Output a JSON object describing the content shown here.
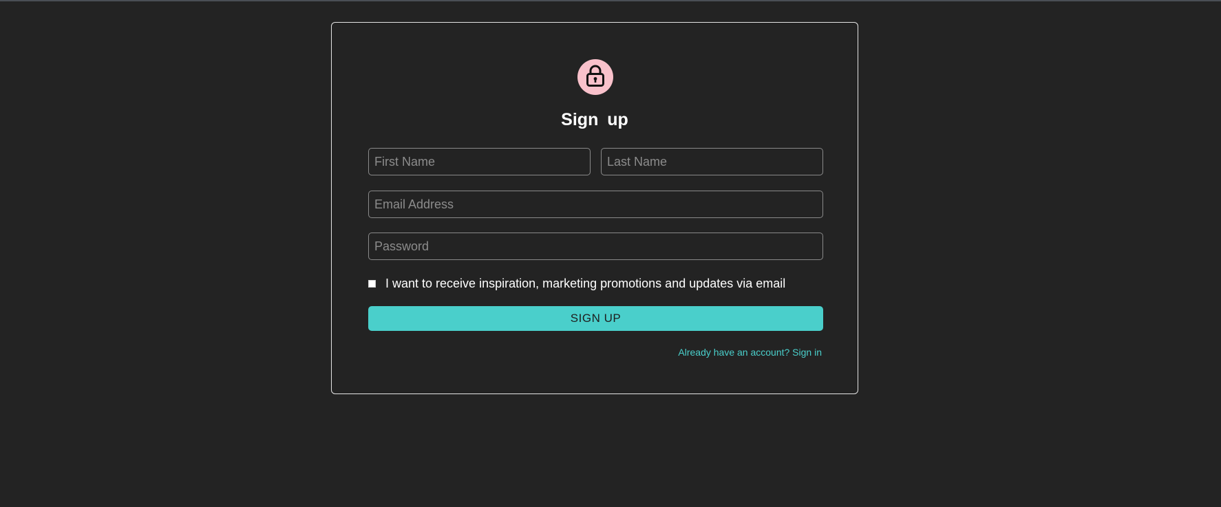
{
  "colors": {
    "background": "#232323",
    "card_border": "#e6e6e6",
    "avatar_bg": "#f9c1cb",
    "accent": "#4acfcb",
    "text": "#ffffff",
    "placeholder": "#8c8c8c"
  },
  "header": {
    "icon": "lock-icon",
    "title": "Sign  up"
  },
  "form": {
    "first_name": {
      "placeholder": "First Name",
      "value": ""
    },
    "last_name": {
      "placeholder": "Last Name",
      "value": ""
    },
    "email": {
      "placeholder": "Email Address",
      "value": ""
    },
    "password": {
      "placeholder": "Password",
      "value": ""
    },
    "consent": {
      "label": "I want to receive inspiration, marketing promotions and updates via email",
      "checked": false
    },
    "submit_label": "SIGN UP",
    "signin_link": "Already have an account? Sign in"
  }
}
